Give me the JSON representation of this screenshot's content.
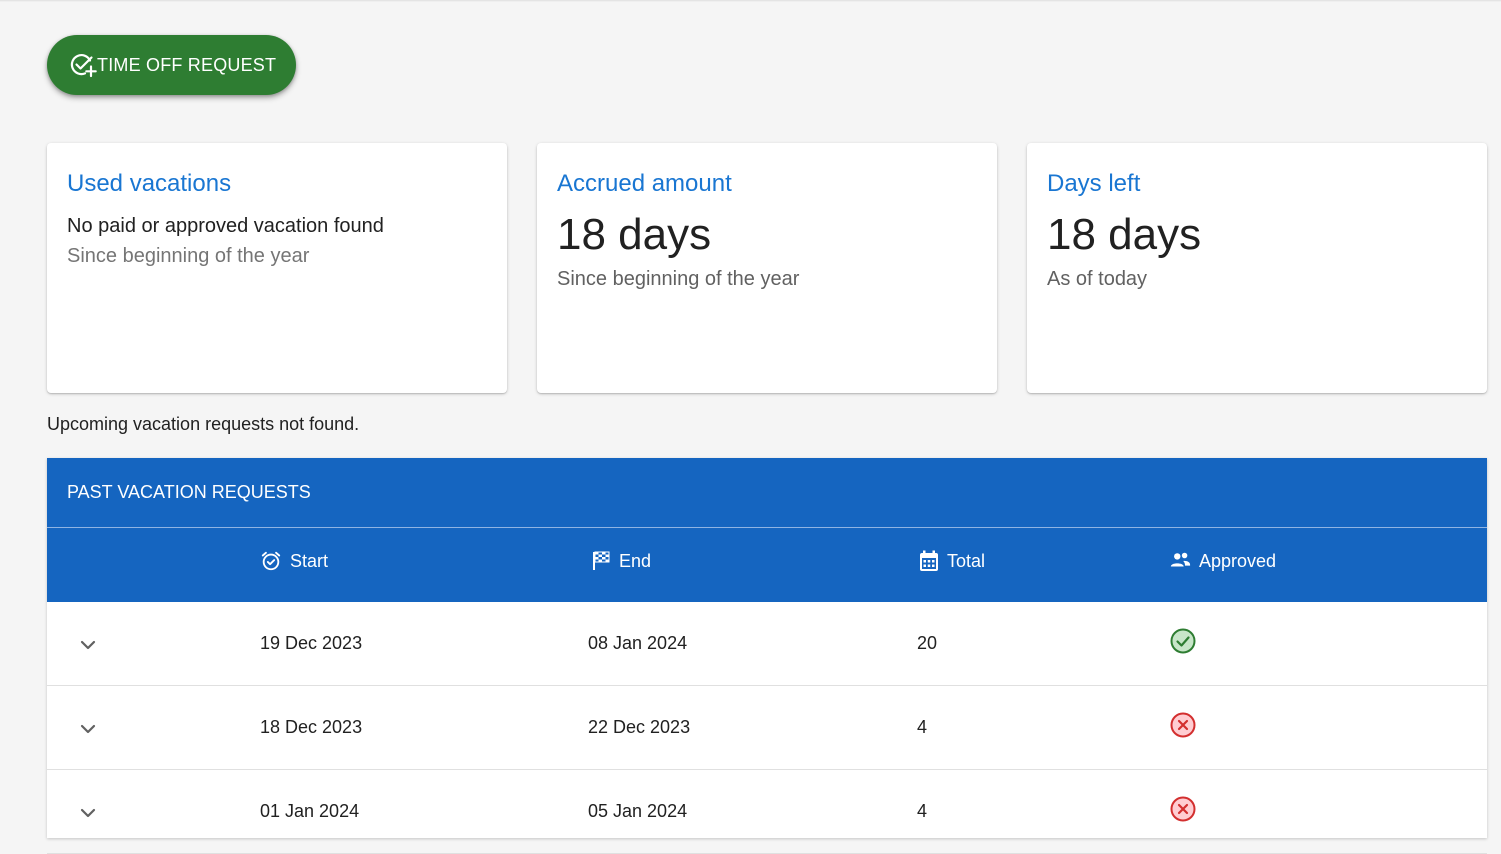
{
  "toolbar": {
    "request_button_label": "TIME OFF REQUEST",
    "accent_color": "#2e7d32"
  },
  "cards": {
    "used": {
      "title": "Used vacations",
      "message": "No paid or approved vacation found",
      "subtitle": "Since beginning of the year"
    },
    "accrued": {
      "title": "Accrued amount",
      "value": "18 days",
      "subtitle": "Since beginning of the year"
    },
    "left": {
      "title": "Days left",
      "value": "18 days",
      "subtitle": "As of today"
    },
    "title_color": "#1976d2"
  },
  "upcoming": {
    "message": "Upcoming vacation requests not found."
  },
  "past": {
    "title": "PAST VACATION REQUESTS",
    "header_color": "#1565c0",
    "columns": {
      "start": "Start",
      "end": "End",
      "total": "Total",
      "approved": "Approved"
    },
    "icons": {
      "start": "alarm-check-icon",
      "end": "checkered-flag-icon",
      "total": "calendar-icon",
      "approved": "people-icon"
    },
    "rows": [
      {
        "start": "19 Dec 2023",
        "end": "08 Jan 2024",
        "total": "20",
        "approved": true,
        "status_icon": "check-circle-icon"
      },
      {
        "start": "18 Dec 2023",
        "end": "22 Dec 2023",
        "total": "4",
        "approved": false,
        "status_icon": "cancel-circle-icon"
      },
      {
        "start": "01 Jan 2024",
        "end": "05 Jan 2024",
        "total": "4",
        "approved": false,
        "status_icon": "cancel-circle-icon"
      }
    ],
    "status_colors": {
      "approved": "#2e7d32",
      "rejected": "#d32f2f"
    }
  }
}
